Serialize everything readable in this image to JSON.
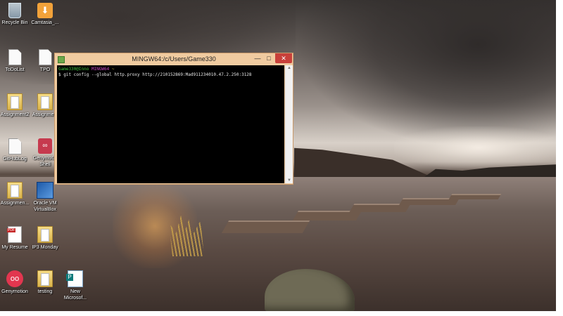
{
  "desktop": {
    "icons": {
      "recycle_bin": "Recycle Bin",
      "camtasia": "Camtasia_...",
      "todolist": "ToDoList",
      "tpo": "TPO",
      "assignment2": "Assignment2",
      "assignme": "Assignme...",
      "githublog": "GitHubLog",
      "genymotion_shell_l1": "Genymot...",
      "genymotion_shell_l2": "Shell",
      "assignmen": "Assignmen...",
      "oracle_vm_l1": "Oracle VM",
      "oracle_vm_l2": "VirtualBox",
      "my_resume": "My Resume",
      "ip3_monday": "IP3 Monday",
      "genymotion": "Genymotion",
      "testing": "testing",
      "new_microsoft_l1": "New",
      "new_microsoft_l2": "Microsof..."
    }
  },
  "terminal": {
    "title": "MINGW64:/c/Users/Game330",
    "buttons": {
      "minimize": "—",
      "maximize": "□",
      "close": "✕"
    },
    "prompt": {
      "user_host": "Game330@Inno",
      "system": "MINGW64",
      "path": "~"
    },
    "command": "$ git config --global http.proxy http://210152869:Mad911234010.47.2.250:3128"
  },
  "colors": {
    "window_frame": "#f0cba0",
    "close_button": "#c8403a",
    "console_bg": "#000000",
    "prompt_green": "#3fc23f",
    "prompt_purple": "#c54ac5",
    "prompt_yellow": "#c7b74a"
  }
}
